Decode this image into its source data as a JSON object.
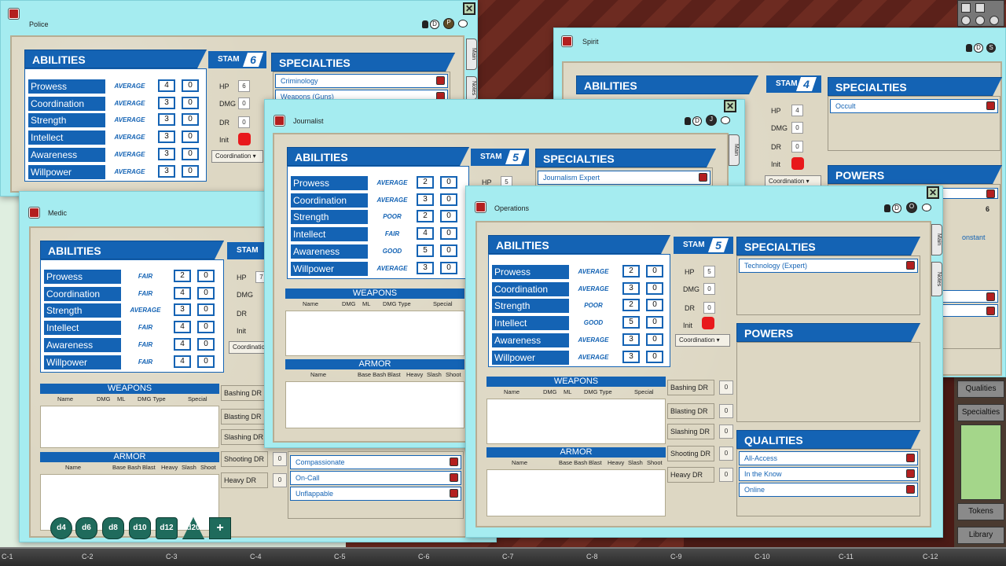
{
  "colors": {
    "accent": "#1463b4",
    "window": "#a5ecf0",
    "sheet": "#ddd7c3",
    "init": "#e8191c"
  },
  "grid": [
    "C-1",
    "C-2",
    "C-3",
    "C-4",
    "C-5",
    "C-6",
    "C-7",
    "C-8",
    "C-9",
    "C-10",
    "C-11",
    "C-12"
  ],
  "right_panel": {
    "qualities": "Qualities",
    "specialties": "Specialties",
    "tokens": "Tokens",
    "library": "Library"
  },
  "dice": [
    "d4",
    "d6",
    "d8",
    "d10",
    "d12",
    "d20",
    "+"
  ],
  "labels": {
    "abilities": "ABILITIES",
    "specialties": "SPECIALTIES",
    "powers": "POWERS",
    "qualities": "QUALITIES",
    "stam": "STAM",
    "hp": "HP",
    "dmg": "DMG",
    "dr": "DR",
    "init": "Init",
    "coord_dd": "Coordination",
    "weapons": "WEAPONS",
    "armor": "ARMOR",
    "main_tab": "Main",
    "notes_tab": "Notes",
    "w_name": "Name",
    "w_dmg": "DMG",
    "w_ml": "ML",
    "w_type": "DMG Type",
    "w_special": "Special",
    "a_name": "Name",
    "a_base": "Base Bash",
    "a_blast": "Blast",
    "a_heavy": "Heavy",
    "a_slash": "Slash",
    "a_shoot": "Shoot",
    "bashing_dr": "Bashing DR",
    "blasting_dr": "Blasting DR",
    "slashing_dr": "Slashing DR",
    "shooting_dr": "Shooting DR",
    "heavy_dr": "Heavy DR"
  },
  "police": {
    "title": "Police",
    "stam": "6",
    "hp": "6",
    "dmg": "0",
    "dr": "0",
    "abilities": [
      {
        "name": "Prowess",
        "rank": "AVERAGE",
        "v": "4",
        "m": "0"
      },
      {
        "name": "Coordination",
        "rank": "AVERAGE",
        "v": "3",
        "m": "0"
      },
      {
        "name": "Strength",
        "rank": "AVERAGE",
        "v": "3",
        "m": "0"
      },
      {
        "name": "Intellect",
        "rank": "AVERAGE",
        "v": "3",
        "m": "0"
      },
      {
        "name": "Awareness",
        "rank": "AVERAGE",
        "v": "3",
        "m": "0"
      },
      {
        "name": "Willpower",
        "rank": "AVERAGE",
        "v": "3",
        "m": "0"
      }
    ],
    "specialties": [
      "Criminology",
      "Weapons (Guns)"
    ]
  },
  "spirit": {
    "title": "Spirit",
    "stam": "4",
    "hp": "4",
    "dmg": "0",
    "dr": "0",
    "specialties": [
      "Occult"
    ],
    "power_value": "6",
    "power_text": "onstant"
  },
  "journalist": {
    "title": "Journalist",
    "stam": "5",
    "hp": "5",
    "abilities": [
      {
        "name": "Prowess",
        "rank": "AVERAGE",
        "v": "2",
        "m": "0"
      },
      {
        "name": "Coordination",
        "rank": "AVERAGE",
        "v": "3",
        "m": "0"
      },
      {
        "name": "Strength",
        "rank": "POOR",
        "v": "2",
        "m": "0"
      },
      {
        "name": "Intellect",
        "rank": "FAIR",
        "v": "4",
        "m": "0"
      },
      {
        "name": "Awareness",
        "rank": "GOOD",
        "v": "5",
        "m": "0"
      },
      {
        "name": "Willpower",
        "rank": "AVERAGE",
        "v": "3",
        "m": "0"
      }
    ],
    "specialties": [
      "Journalism Expert"
    ],
    "qualities": [
      "Compassionate",
      "On-Call",
      "Unflappable"
    ]
  },
  "medic": {
    "title": "Medic",
    "hp": "7",
    "abilities": [
      {
        "name": "Prowess",
        "rank": "FAIR",
        "v": "2",
        "m": "0"
      },
      {
        "name": "Coordination",
        "rank": "FAIR",
        "v": "4",
        "m": "0"
      },
      {
        "name": "Strength",
        "rank": "AVERAGE",
        "v": "3",
        "m": "0"
      },
      {
        "name": "Intellect",
        "rank": "FAIR",
        "v": "4",
        "m": "0"
      },
      {
        "name": "Awareness",
        "rank": "FAIR",
        "v": "4",
        "m": "0"
      },
      {
        "name": "Willpower",
        "rank": "FAIR",
        "v": "4",
        "m": "0"
      }
    ],
    "dr_values": [
      "0",
      "0"
    ]
  },
  "operations": {
    "title": "Operations",
    "stam": "5",
    "hp": "5",
    "dmg": "0",
    "dr": "0",
    "abilities": [
      {
        "name": "Prowess",
        "rank": "AVERAGE",
        "v": "2",
        "m": "0"
      },
      {
        "name": "Coordination",
        "rank": "AVERAGE",
        "v": "3",
        "m": "0"
      },
      {
        "name": "Strength",
        "rank": "POOR",
        "v": "2",
        "m": "0"
      },
      {
        "name": "Intellect",
        "rank": "GOOD",
        "v": "5",
        "m": "0"
      },
      {
        "name": "Awareness",
        "rank": "AVERAGE",
        "v": "3",
        "m": "0"
      },
      {
        "name": "Willpower",
        "rank": "AVERAGE",
        "v": "3",
        "m": "0"
      }
    ],
    "specialties": [
      "Technology (Expert)"
    ],
    "qualities": [
      "All-Access",
      "In the Know",
      "Online"
    ],
    "dr_values": [
      "0",
      "0",
      "0",
      "0",
      "0"
    ]
  }
}
